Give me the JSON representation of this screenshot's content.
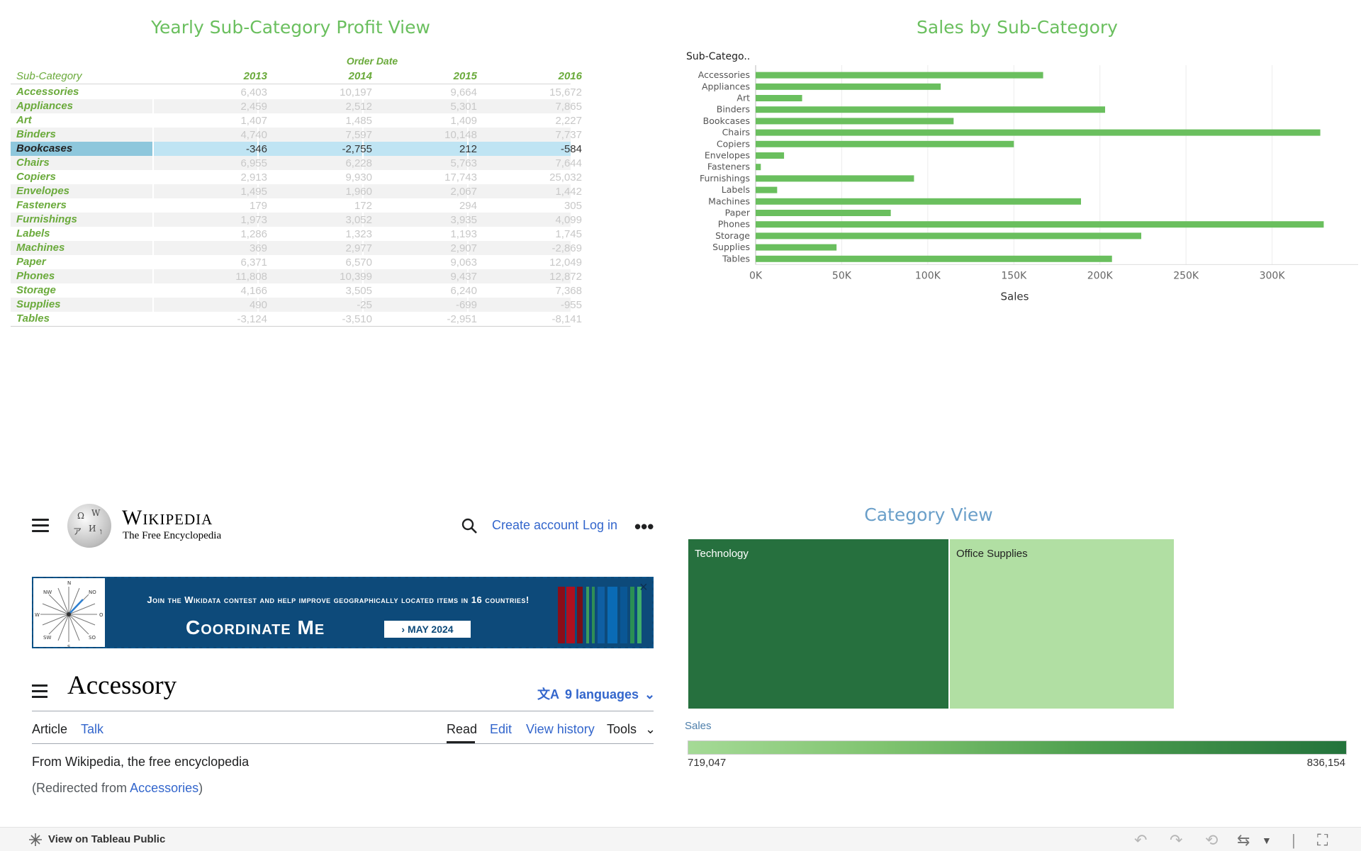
{
  "profit_view": {
    "title": "Yearly Sub-Category Profit View",
    "column_group": "Order Date",
    "row_header": "Sub-Category",
    "years": [
      "2013",
      "2014",
      "2015",
      "2016"
    ],
    "highlighted_row": "Bookcases",
    "rows": [
      {
        "name": "Accessories",
        "values": [
          "6,403",
          "10,197",
          "9,664",
          "15,672"
        ]
      },
      {
        "name": "Appliances",
        "values": [
          "2,459",
          "2,512",
          "5,301",
          "7,865"
        ]
      },
      {
        "name": "Art",
        "values": [
          "1,407",
          "1,485",
          "1,409",
          "2,227"
        ]
      },
      {
        "name": "Binders",
        "values": [
          "4,740",
          "7,597",
          "10,148",
          "7,737"
        ]
      },
      {
        "name": "Bookcases",
        "values": [
          "-346",
          "-2,755",
          "212",
          "-584"
        ]
      },
      {
        "name": "Chairs",
        "values": [
          "6,955",
          "6,228",
          "5,763",
          "7,644"
        ]
      },
      {
        "name": "Copiers",
        "values": [
          "2,913",
          "9,930",
          "17,743",
          "25,032"
        ]
      },
      {
        "name": "Envelopes",
        "values": [
          "1,495",
          "1,960",
          "2,067",
          "1,442"
        ]
      },
      {
        "name": "Fasteners",
        "values": [
          "179",
          "172",
          "294",
          "305"
        ]
      },
      {
        "name": "Furnishings",
        "values": [
          "1,973",
          "3,052",
          "3,935",
          "4,099"
        ]
      },
      {
        "name": "Labels",
        "values": [
          "1,286",
          "1,323",
          "1,193",
          "1,745"
        ]
      },
      {
        "name": "Machines",
        "values": [
          "369",
          "2,977",
          "2,907",
          "-2,869"
        ]
      },
      {
        "name": "Paper",
        "values": [
          "6,371",
          "6,570",
          "9,063",
          "12,049"
        ]
      },
      {
        "name": "Phones",
        "values": [
          "11,808",
          "10,399",
          "9,437",
          "12,872"
        ]
      },
      {
        "name": "Storage",
        "values": [
          "4,166",
          "3,505",
          "6,240",
          "7,368"
        ]
      },
      {
        "name": "Supplies",
        "values": [
          "490",
          "-25",
          "-699",
          "-955"
        ]
      },
      {
        "name": "Tables",
        "values": [
          "-3,124",
          "-3,510",
          "-2,951",
          "-8,141"
        ]
      }
    ]
  },
  "chart_data": {
    "type": "bar",
    "orientation": "horizontal",
    "title": "Sales by Sub-Category",
    "ylabel": "Sub-Catego..",
    "xlabel": "Sales",
    "categories": [
      "Accessories",
      "Appliances",
      "Art",
      "Binders",
      "Bookcases",
      "Chairs",
      "Copiers",
      "Envelopes",
      "Fasteners",
      "Furnishings",
      "Labels",
      "Machines",
      "Paper",
      "Phones",
      "Storage",
      "Supplies",
      "Tables"
    ],
    "values": [
      167000,
      107500,
      27000,
      203000,
      115000,
      328000,
      150000,
      16500,
      3000,
      92000,
      12500,
      189000,
      78500,
      330000,
      224000,
      47000,
      207000
    ],
    "xlim": [
      0,
      350000
    ],
    "x_ticks": [
      0,
      50000,
      100000,
      150000,
      200000,
      250000,
      300000
    ],
    "x_tick_labels": [
      "0K",
      "50K",
      "100K",
      "150K",
      "200K",
      "250K",
      "300K"
    ],
    "bar_color": "#6abf5e",
    "grid": true
  },
  "wikipedia": {
    "wordmark": "Wikipedia",
    "tagline": "The Free Encyclopedia",
    "create_account": "Create account",
    "log_in": "Log in",
    "more_icon": "ellipsis-icon",
    "banner": {
      "line1": "Join the Wikidata contest and help improve geographically located items in 16 countries!",
      "headline": "Coordinate Me",
      "button": "› MAY 2024",
      "compass_n": "N",
      "compass_s": "S",
      "compass_w": "W",
      "compass_o": "O",
      "compass_nw": "NW",
      "compass_no": "NO",
      "compass_sw": "SW",
      "compass_so": "SO"
    },
    "page_title": "Accessory",
    "languages": "9 languages",
    "tabs": {
      "article": "Article",
      "talk": "Talk",
      "read": "Read",
      "edit": "Edit",
      "history": "View history",
      "tools": "Tools"
    },
    "from_text": "From Wikipedia, the free encyclopedia",
    "redirect_prefix": "(Redirected from ",
    "redirect_link": "Accessories",
    "redirect_suffix": ")"
  },
  "category_view": {
    "title": "Category View",
    "cells": [
      {
        "label": "Technology",
        "value": 836154,
        "color": "#26703e"
      },
      {
        "label": "Office Supplies",
        "value": 719047,
        "color": "#b1dfa3"
      }
    ],
    "legend_title": "Sales",
    "legend_min": "719,047",
    "legend_max": "836,154"
  },
  "footer": {
    "view_on": "View on Tableau Public",
    "icons": [
      "undo-icon",
      "redo-icon",
      "revert-icon",
      "share-icon",
      "dropdown-icon",
      "fullscreen-icon"
    ]
  }
}
